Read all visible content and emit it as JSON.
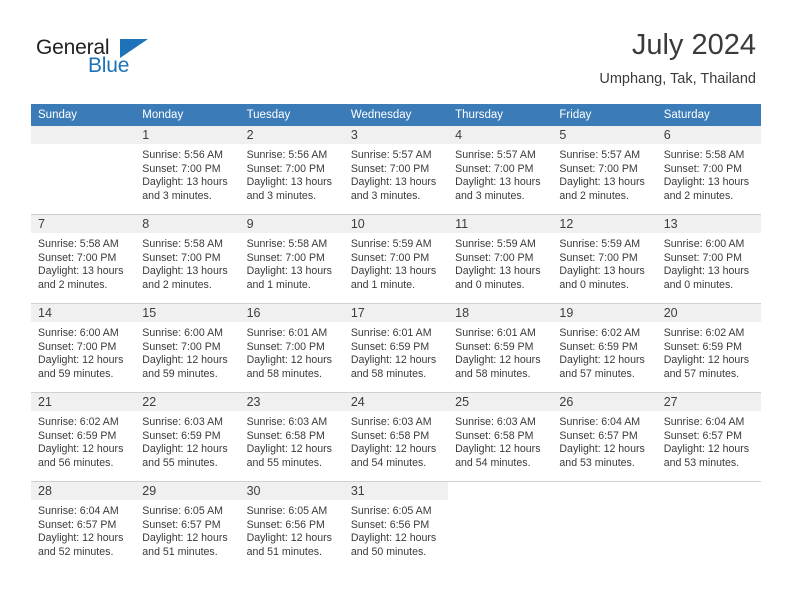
{
  "brand": {
    "name_top": "General",
    "name_bottom": "Blue",
    "accent_color": "#1e72b8"
  },
  "header": {
    "title": "July 2024",
    "subtitle": "Umphang, Tak, Thailand"
  },
  "theme": {
    "header_row_bg": "#3b7cb8",
    "daynum_band_bg": "#f0f0f0",
    "text_color": "#3a3a3a"
  },
  "calendar": {
    "weekday_headers": [
      "Sunday",
      "Monday",
      "Tuesday",
      "Wednesday",
      "Thursday",
      "Friday",
      "Saturday"
    ],
    "weeks": [
      [
        {
          "day": "",
          "lines": []
        },
        {
          "day": "1",
          "lines": [
            "Sunrise: 5:56 AM",
            "Sunset: 7:00 PM",
            "Daylight: 13 hours",
            "and 3 minutes."
          ]
        },
        {
          "day": "2",
          "lines": [
            "Sunrise: 5:56 AM",
            "Sunset: 7:00 PM",
            "Daylight: 13 hours",
            "and 3 minutes."
          ]
        },
        {
          "day": "3",
          "lines": [
            "Sunrise: 5:57 AM",
            "Sunset: 7:00 PM",
            "Daylight: 13 hours",
            "and 3 minutes."
          ]
        },
        {
          "day": "4",
          "lines": [
            "Sunrise: 5:57 AM",
            "Sunset: 7:00 PM",
            "Daylight: 13 hours",
            "and 3 minutes."
          ]
        },
        {
          "day": "5",
          "lines": [
            "Sunrise: 5:57 AM",
            "Sunset: 7:00 PM",
            "Daylight: 13 hours",
            "and 2 minutes."
          ]
        },
        {
          "day": "6",
          "lines": [
            "Sunrise: 5:58 AM",
            "Sunset: 7:00 PM",
            "Daylight: 13 hours",
            "and 2 minutes."
          ]
        }
      ],
      [
        {
          "day": "7",
          "lines": [
            "Sunrise: 5:58 AM",
            "Sunset: 7:00 PM",
            "Daylight: 13 hours",
            "and 2 minutes."
          ]
        },
        {
          "day": "8",
          "lines": [
            "Sunrise: 5:58 AM",
            "Sunset: 7:00 PM",
            "Daylight: 13 hours",
            "and 2 minutes."
          ]
        },
        {
          "day": "9",
          "lines": [
            "Sunrise: 5:58 AM",
            "Sunset: 7:00 PM",
            "Daylight: 13 hours",
            "and 1 minute."
          ]
        },
        {
          "day": "10",
          "lines": [
            "Sunrise: 5:59 AM",
            "Sunset: 7:00 PM",
            "Daylight: 13 hours",
            "and 1 minute."
          ]
        },
        {
          "day": "11",
          "lines": [
            "Sunrise: 5:59 AM",
            "Sunset: 7:00 PM",
            "Daylight: 13 hours",
            "and 0 minutes."
          ]
        },
        {
          "day": "12",
          "lines": [
            "Sunrise: 5:59 AM",
            "Sunset: 7:00 PM",
            "Daylight: 13 hours",
            "and 0 minutes."
          ]
        },
        {
          "day": "13",
          "lines": [
            "Sunrise: 6:00 AM",
            "Sunset: 7:00 PM",
            "Daylight: 13 hours",
            "and 0 minutes."
          ]
        }
      ],
      [
        {
          "day": "14",
          "lines": [
            "Sunrise: 6:00 AM",
            "Sunset: 7:00 PM",
            "Daylight: 12 hours",
            "and 59 minutes."
          ]
        },
        {
          "day": "15",
          "lines": [
            "Sunrise: 6:00 AM",
            "Sunset: 7:00 PM",
            "Daylight: 12 hours",
            "and 59 minutes."
          ]
        },
        {
          "day": "16",
          "lines": [
            "Sunrise: 6:01 AM",
            "Sunset: 7:00 PM",
            "Daylight: 12 hours",
            "and 58 minutes."
          ]
        },
        {
          "day": "17",
          "lines": [
            "Sunrise: 6:01 AM",
            "Sunset: 6:59 PM",
            "Daylight: 12 hours",
            "and 58 minutes."
          ]
        },
        {
          "day": "18",
          "lines": [
            "Sunrise: 6:01 AM",
            "Sunset: 6:59 PM",
            "Daylight: 12 hours",
            "and 58 minutes."
          ]
        },
        {
          "day": "19",
          "lines": [
            "Sunrise: 6:02 AM",
            "Sunset: 6:59 PM",
            "Daylight: 12 hours",
            "and 57 minutes."
          ]
        },
        {
          "day": "20",
          "lines": [
            "Sunrise: 6:02 AM",
            "Sunset: 6:59 PM",
            "Daylight: 12 hours",
            "and 57 minutes."
          ]
        }
      ],
      [
        {
          "day": "21",
          "lines": [
            "Sunrise: 6:02 AM",
            "Sunset: 6:59 PM",
            "Daylight: 12 hours",
            "and 56 minutes."
          ]
        },
        {
          "day": "22",
          "lines": [
            "Sunrise: 6:03 AM",
            "Sunset: 6:59 PM",
            "Daylight: 12 hours",
            "and 55 minutes."
          ]
        },
        {
          "day": "23",
          "lines": [
            "Sunrise: 6:03 AM",
            "Sunset: 6:58 PM",
            "Daylight: 12 hours",
            "and 55 minutes."
          ]
        },
        {
          "day": "24",
          "lines": [
            "Sunrise: 6:03 AM",
            "Sunset: 6:58 PM",
            "Daylight: 12 hours",
            "and 54 minutes."
          ]
        },
        {
          "day": "25",
          "lines": [
            "Sunrise: 6:03 AM",
            "Sunset: 6:58 PM",
            "Daylight: 12 hours",
            "and 54 minutes."
          ]
        },
        {
          "day": "26",
          "lines": [
            "Sunrise: 6:04 AM",
            "Sunset: 6:57 PM",
            "Daylight: 12 hours",
            "and 53 minutes."
          ]
        },
        {
          "day": "27",
          "lines": [
            "Sunrise: 6:04 AM",
            "Sunset: 6:57 PM",
            "Daylight: 12 hours",
            "and 53 minutes."
          ]
        }
      ],
      [
        {
          "day": "28",
          "lines": [
            "Sunrise: 6:04 AM",
            "Sunset: 6:57 PM",
            "Daylight: 12 hours",
            "and 52 minutes."
          ]
        },
        {
          "day": "29",
          "lines": [
            "Sunrise: 6:05 AM",
            "Sunset: 6:57 PM",
            "Daylight: 12 hours",
            "and 51 minutes."
          ]
        },
        {
          "day": "30",
          "lines": [
            "Sunrise: 6:05 AM",
            "Sunset: 6:56 PM",
            "Daylight: 12 hours",
            "and 51 minutes."
          ]
        },
        {
          "day": "31",
          "lines": [
            "Sunrise: 6:05 AM",
            "Sunset: 6:56 PM",
            "Daylight: 12 hours",
            "and 50 minutes."
          ]
        },
        {
          "day": "",
          "lines": []
        },
        {
          "day": "",
          "lines": []
        },
        {
          "day": "",
          "lines": []
        }
      ]
    ]
  }
}
